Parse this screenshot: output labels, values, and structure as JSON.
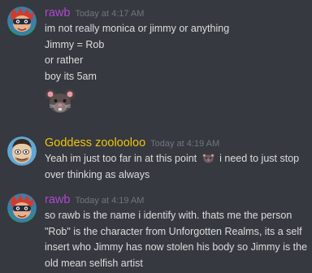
{
  "messages": [
    {
      "author": "rawb",
      "author_color": "#b148d2",
      "timestamp": "Today at 4:17 AM",
      "avatar_icon": "avatar-rawb-masked-character",
      "lines": [
        "im not really monica or jimmy or anything",
        "Jimmy = Rob",
        "or rather",
        "boy its 5am"
      ],
      "attachment_icon": "rat-emoji"
    },
    {
      "author": "Goddess zoolooloo",
      "author_color": "#f1c40f",
      "timestamp": "Today at 4:19 AM",
      "avatar_icon": "avatar-zoolooloo-cartoon-face",
      "line1_before": "Yeah im just too far in at this point",
      "inline_emoji_icon": "rat-face-emoji",
      "line1_after": "i need to just stop",
      "line2": "over thinking as always"
    },
    {
      "author": "rawb",
      "author_color": "#b148d2",
      "timestamp": "Today at 4:19 AM",
      "avatar_icon": "avatar-rawb-masked-character",
      "lines": [
        "so rawb is the name i identify with. thats me the person",
        "\"Rob\" is the character from Unforgotten Realms, its a self",
        "insert who Jimmy has now stolen his body so Jimmy is the",
        "old mean selfish artist"
      ]
    }
  ]
}
